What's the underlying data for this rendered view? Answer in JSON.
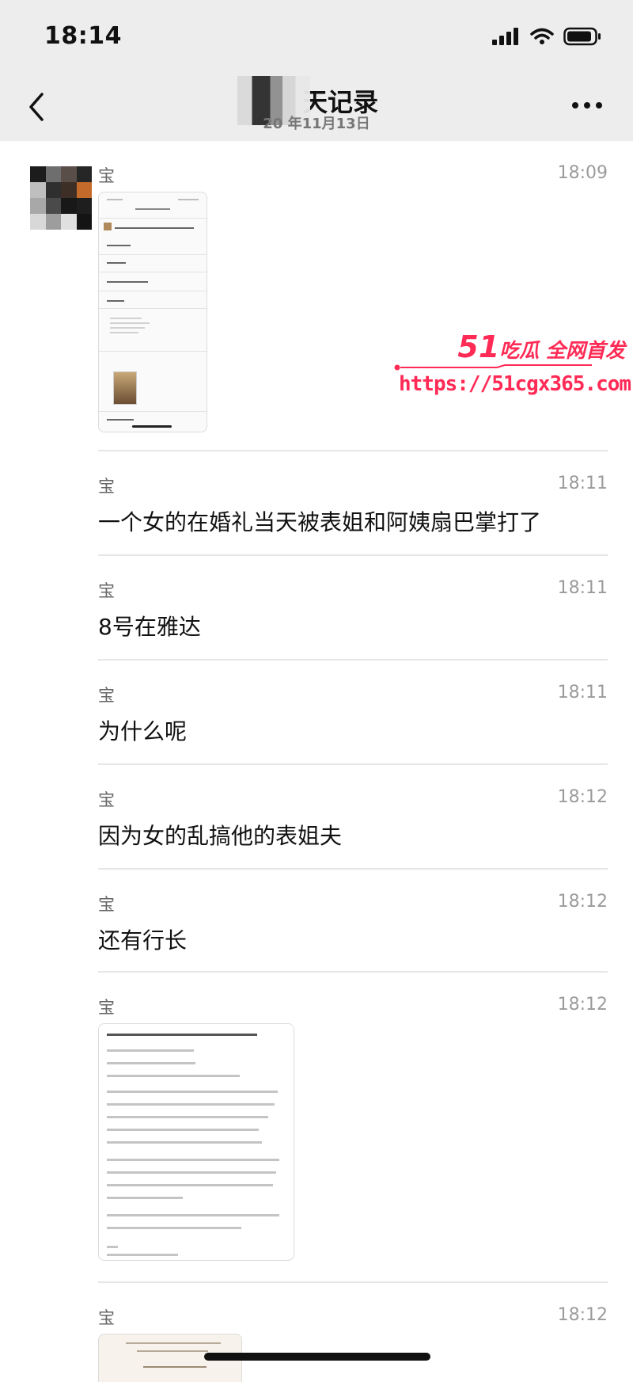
{
  "status_bar": {
    "time": "18:14"
  },
  "nav": {
    "title": "天记录",
    "subtitle": "20 年11月13日",
    "title_prefix": ""
  },
  "messages": [
    {
      "sender": "宝",
      "time": "18:09",
      "type": "image"
    },
    {
      "sender": "宝",
      "time": "18:11",
      "type": "text",
      "text": "一个女的在婚礼当天被表姐和阿姨扇巴掌打了"
    },
    {
      "sender": "宝",
      "time": "18:11",
      "type": "text",
      "text": "8号在雅达"
    },
    {
      "sender": "宝",
      "time": "18:11",
      "type": "text",
      "text": "为什么呢"
    },
    {
      "sender": "宝",
      "time": "18:12",
      "type": "text",
      "text": "因为女的乱搞他的表姐夫"
    },
    {
      "sender": "宝",
      "time": "18:12",
      "type": "text",
      "text": "还有行长"
    },
    {
      "sender": "宝",
      "time": "18:12",
      "type": "image"
    },
    {
      "sender": "宝",
      "time": "18:12",
      "type": "image"
    }
  ],
  "watermark": {
    "brand_number": "51",
    "brand_text": "吃瓜 全网首发",
    "url": "https://51cgx365.com",
    "color": "#ff2a55"
  },
  "colors": {
    "header_bg": "#ededed",
    "time_text": "#9b9b9b",
    "divider": "#e6e6e6"
  }
}
